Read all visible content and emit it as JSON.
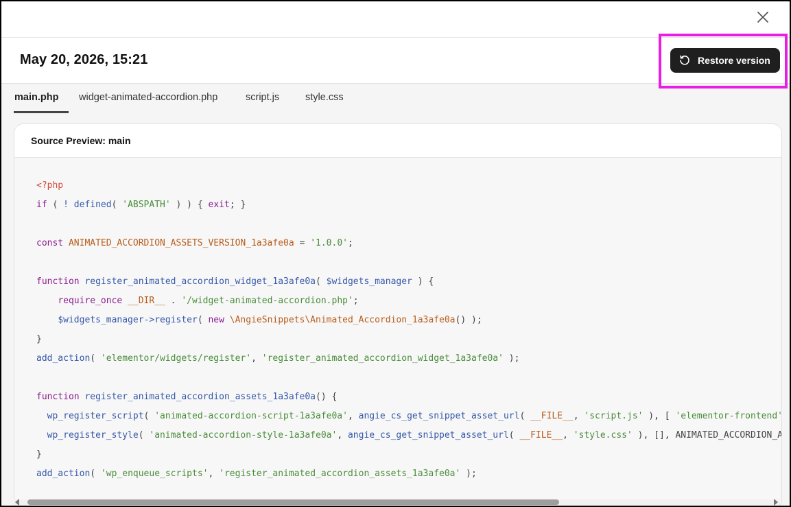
{
  "header": {
    "title": "May 20, 2026, 15:21",
    "restore_label": "Restore version"
  },
  "tabs": [
    {
      "label": "main.php",
      "active": true
    },
    {
      "label": "widget-animated-accordion.php",
      "active": false
    },
    {
      "label": "script.js",
      "active": false
    },
    {
      "label": "style.css",
      "active": false
    }
  ],
  "preview": {
    "title": "Source Preview: main"
  },
  "code_lines": [
    [
      {
        "t": "<?php",
        "c": "tag"
      }
    ],
    [
      {
        "t": "if",
        "c": "kw"
      },
      {
        "t": " ( ",
        "c": "pl"
      },
      {
        "t": "!",
        "c": "fn"
      },
      {
        "t": " ",
        "c": "pl"
      },
      {
        "t": "defined",
        "c": "fn"
      },
      {
        "t": "( ",
        "c": "pl"
      },
      {
        "t": "'ABSPATH'",
        "c": "str"
      },
      {
        "t": " ) ) { ",
        "c": "pl"
      },
      {
        "t": "exit",
        "c": "kw"
      },
      {
        "t": "; }",
        "c": "pl"
      }
    ],
    [],
    [
      {
        "t": "const",
        "c": "kw"
      },
      {
        "t": " ",
        "c": "pl"
      },
      {
        "t": "ANIMATED_ACCORDION_ASSETS_VERSION_1a3afe0a",
        "c": "cst"
      },
      {
        "t": " = ",
        "c": "pl"
      },
      {
        "t": "'1.0.0'",
        "c": "str"
      },
      {
        "t": ";",
        "c": "pl"
      }
    ],
    [],
    [
      {
        "t": "function",
        "c": "kw"
      },
      {
        "t": " ",
        "c": "pl"
      },
      {
        "t": "register_animated_accordion_widget_1a3afe0a",
        "c": "fn"
      },
      {
        "t": "( ",
        "c": "pl"
      },
      {
        "t": "$widgets_manager",
        "c": "fn"
      },
      {
        "t": " ) {",
        "c": "pl"
      }
    ],
    [
      {
        "t": "    ",
        "c": "pl"
      },
      {
        "t": "require_once",
        "c": "kw"
      },
      {
        "t": " ",
        "c": "pl"
      },
      {
        "t": "__DIR__",
        "c": "cst"
      },
      {
        "t": " . ",
        "c": "pl"
      },
      {
        "t": "'/widget-animated-accordion.php'",
        "c": "str"
      },
      {
        "t": ";",
        "c": "pl"
      }
    ],
    [
      {
        "t": "    ",
        "c": "pl"
      },
      {
        "t": "$widgets_manager->register",
        "c": "fn"
      },
      {
        "t": "( ",
        "c": "pl"
      },
      {
        "t": "new",
        "c": "kw"
      },
      {
        "t": " ",
        "c": "pl"
      },
      {
        "t": "\\AngieSnippets\\Animated_Accordion_1a3afe0a",
        "c": "cst"
      },
      {
        "t": "() );",
        "c": "pl"
      }
    ],
    [
      {
        "t": "}",
        "c": "pl"
      }
    ],
    [
      {
        "t": "add_action",
        "c": "fn"
      },
      {
        "t": "( ",
        "c": "pl"
      },
      {
        "t": "'elementor/widgets/register'",
        "c": "str"
      },
      {
        "t": ", ",
        "c": "pl"
      },
      {
        "t": "'register_animated_accordion_widget_1a3afe0a'",
        "c": "str"
      },
      {
        "t": " );",
        "c": "pl"
      }
    ],
    [],
    [
      {
        "t": "function",
        "c": "kw"
      },
      {
        "t": " ",
        "c": "pl"
      },
      {
        "t": "register_animated_accordion_assets_1a3afe0a",
        "c": "fn"
      },
      {
        "t": "() {",
        "c": "pl"
      }
    ],
    [
      {
        "t": "  ",
        "c": "pl"
      },
      {
        "t": "wp_register_script",
        "c": "fn"
      },
      {
        "t": "( ",
        "c": "pl"
      },
      {
        "t": "'animated-accordion-script-1a3afe0a'",
        "c": "str"
      },
      {
        "t": ", ",
        "c": "pl"
      },
      {
        "t": "angie_cs_get_snippet_asset_url",
        "c": "fn"
      },
      {
        "t": "( ",
        "c": "pl"
      },
      {
        "t": "__FILE__",
        "c": "cst"
      },
      {
        "t": ", ",
        "c": "pl"
      },
      {
        "t": "'script.js'",
        "c": "str"
      },
      {
        "t": " ), [ ",
        "c": "pl"
      },
      {
        "t": "'elementor-frontend'",
        "c": "str"
      },
      {
        "t": " ]",
        "c": "pl"
      }
    ],
    [
      {
        "t": "  ",
        "c": "pl"
      },
      {
        "t": "wp_register_style",
        "c": "fn"
      },
      {
        "t": "( ",
        "c": "pl"
      },
      {
        "t": "'animated-accordion-style-1a3afe0a'",
        "c": "str"
      },
      {
        "t": ", ",
        "c": "pl"
      },
      {
        "t": "angie_cs_get_snippet_asset_url",
        "c": "fn"
      },
      {
        "t": "( ",
        "c": "pl"
      },
      {
        "t": "__FILE__",
        "c": "cst"
      },
      {
        "t": ", ",
        "c": "pl"
      },
      {
        "t": "'style.css'",
        "c": "str"
      },
      {
        "t": " ), [], ",
        "c": "pl"
      },
      {
        "t": "ANIMATED_ACCORDION_ASS",
        "c": "pl"
      }
    ],
    [
      {
        "t": "}",
        "c": "pl"
      }
    ],
    [
      {
        "t": "add_action",
        "c": "fn"
      },
      {
        "t": "( ",
        "c": "pl"
      },
      {
        "t": "'wp_enqueue_scripts'",
        "c": "str"
      },
      {
        "t": ", ",
        "c": "pl"
      },
      {
        "t": "'register_animated_accordion_assets_1a3afe0a'",
        "c": "str"
      },
      {
        "t": " );",
        "c": "pl"
      }
    ]
  ],
  "icons": {
    "close": "close-icon",
    "restore": "restore-icon"
  },
  "colors": {
    "highlight": "#e91ee3",
    "button_bg": "#1f1f1f"
  }
}
